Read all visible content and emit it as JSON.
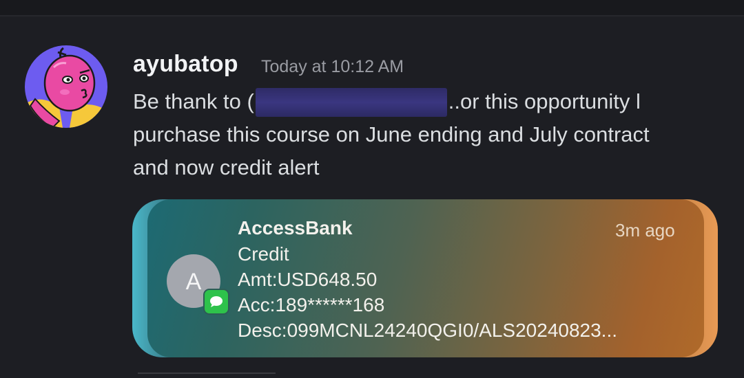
{
  "message": {
    "author": "ayubatop",
    "timestamp": "Today at 10:12 AM",
    "line1_before": "Be thank to (",
    "line1_after": "..or this opportunity l",
    "line2": "purchase this course on June ending and July contract",
    "line3": "and now credit alert"
  },
  "notification": {
    "sender": "AccessBank",
    "time": "3m ago",
    "avatar_letter": "A",
    "line1": "Credit",
    "line2": "Amt:USD648.50",
    "line3": "Acc:189******168",
    "line4": "Desc:099MCNL24240QGI0/ALS20240823..."
  },
  "colors": {
    "background": "#1d1e23",
    "author": "#f2f3f5",
    "timestamp": "#9a9ca3",
    "message_text": "#dbdee1",
    "redaction": "#3a3680",
    "imessage_green": "#2ec24b"
  },
  "icons": {
    "avatar": "pink-cartoon-character-avatar",
    "badge": "imessage-bubble-icon"
  }
}
